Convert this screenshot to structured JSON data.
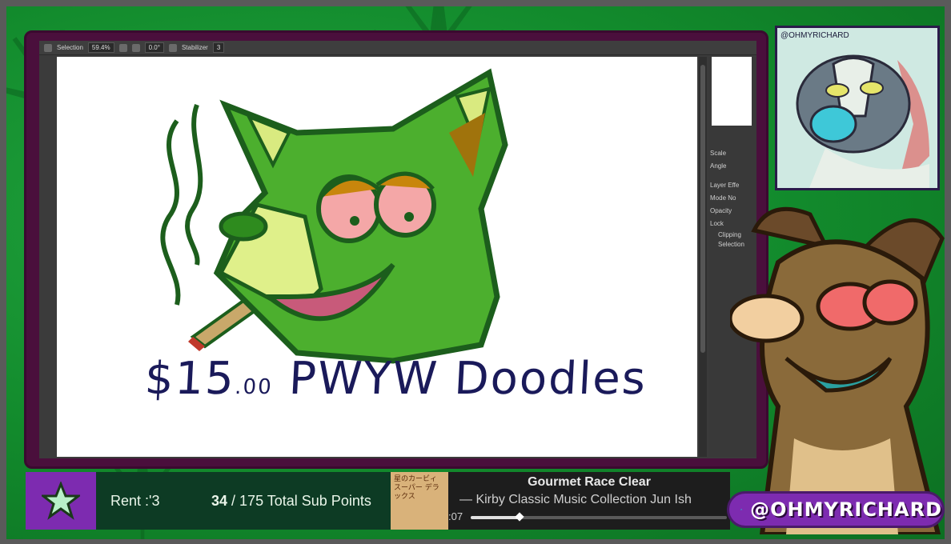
{
  "toolbar": {
    "selection_label": "Selection",
    "zoom": "59.4%",
    "rotation": "0.0°",
    "stabilizer_label": "Stabilizer",
    "stabilizer_value": "3"
  },
  "canvas": {
    "caption_main": "$15",
    "caption_cents": ".00",
    "caption_rest": "PWYW Doodles"
  },
  "right_panel": {
    "scale_label": "Scale",
    "angle_label": "Angle",
    "layer_effect_label": "Layer Effe",
    "mode_label": "Mode",
    "mode_value": "No",
    "opacity_label": "Opacity",
    "lock_label": "Lock",
    "clipping_label": "Clipping",
    "selection_label": "Selection"
  },
  "webcam": {
    "handle_tag": "@OHMYRICHARD"
  },
  "goal": {
    "label": "Rent :'3",
    "current": "34",
    "rest": "/ 175 Total Sub Points"
  },
  "now_playing": {
    "title": "Gourmet Race Clear",
    "subtitle": "— Kirby Classic Music Collection    Jun Ish",
    "time": ":07",
    "progress": 0.19,
    "album_art_text": "星のカービィ スーパー デラックス"
  },
  "twitter": {
    "handle": "@OHMYRICHARD",
    "accent": "#7d2bb0"
  },
  "colors": {
    "background_green": "#128a2c",
    "frame_purple": "#4a0f3c",
    "goal_bg": "#0d3b24",
    "goal_icon_bg": "#7d2bb0"
  }
}
